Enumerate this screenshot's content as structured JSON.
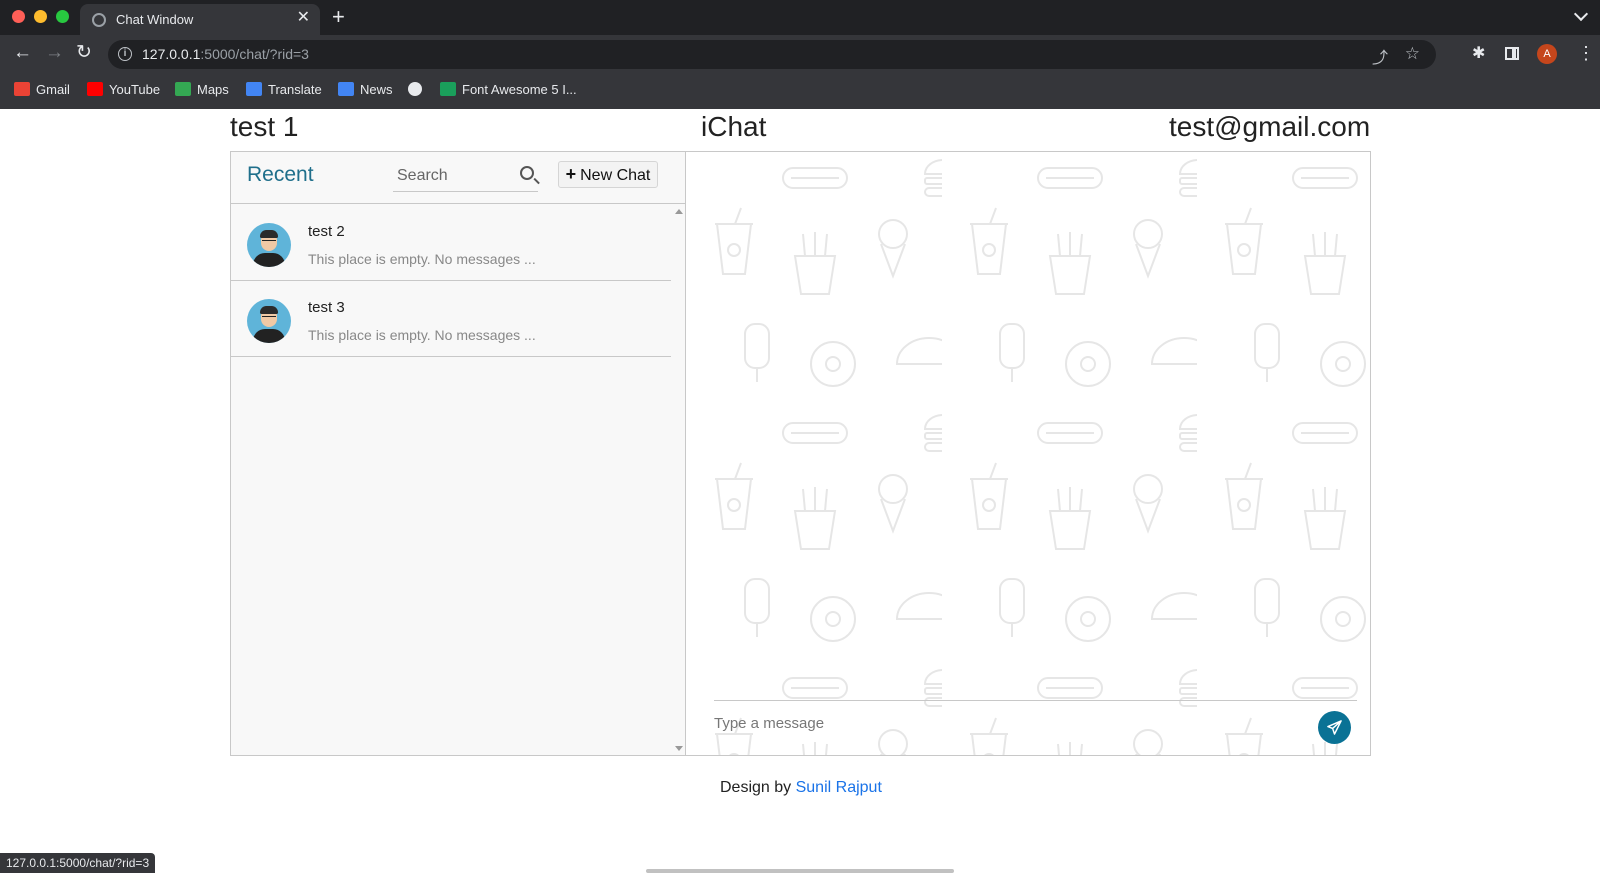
{
  "browser": {
    "tab_title": "Chat Window",
    "tab_close": "✕",
    "new_tab": "+",
    "url_host": "127.0.0.1",
    "url_rest": ":5000/chat/?rid=3",
    "profile_initial": "A",
    "bookmarks": [
      {
        "label": "Gmail",
        "icon": "gmail-icon",
        "color": "#ea4335"
      },
      {
        "label": "YouTube",
        "icon": "youtube-icon",
        "color": "#ff0000"
      },
      {
        "label": "Maps",
        "icon": "maps-icon",
        "color": "#34a853"
      },
      {
        "label": "Translate",
        "icon": "translate-icon",
        "color": "#4285f4"
      },
      {
        "label": "News",
        "icon": "news-icon",
        "color": "#4285f4"
      },
      {
        "label": "",
        "icon": "globe-icon",
        "color": "#e8eaed"
      },
      {
        "label": "Font Awesome 5 I...",
        "icon": "fontawesome-icon",
        "color": "#1a9f5b"
      }
    ],
    "status_url": "127.0.0.1:5000/chat/?rid=3"
  },
  "header": {
    "user": "test 1",
    "app_name": "iChat",
    "email": "test@gmail.com"
  },
  "sidebar": {
    "title": "Recent",
    "search_placeholder": "Search",
    "new_chat_label": "New Chat",
    "chats": [
      {
        "name": "test 2",
        "preview": "This place is empty. No messages ..."
      },
      {
        "name": "test 3",
        "preview": "This place is empty. No messages ..."
      }
    ]
  },
  "conversation": {
    "message_placeholder": "Type a message",
    "accent_color": "#0a7295"
  },
  "footer": {
    "prefix": "Design by",
    "author": "Sunil Rajput"
  }
}
